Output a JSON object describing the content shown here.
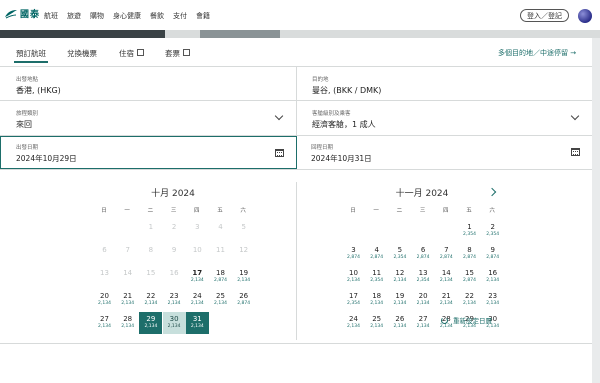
{
  "header": {
    "logo_text": "國泰",
    "nav": [
      "航班",
      "旅遊",
      "購物",
      "身心健康",
      "餐飲",
      "支付",
      "會籍"
    ],
    "login_label": "登入／登記"
  },
  "tabs": [
    {
      "label": "預訂航班"
    },
    {
      "label": "兌換機票"
    },
    {
      "label": "住宿"
    },
    {
      "label": "套票"
    }
  ],
  "multi_city_link": "多個目的地／中途停留 →",
  "form": {
    "origin_label": "出發地點",
    "origin_value": "香港, (HKG)",
    "destination_label": "目的地",
    "destination_value": "曼谷, (BKK / DMK)",
    "trip_type_label": "旅程類別",
    "trip_type_value": "來回",
    "cabin_label": "客艙級別及乘客",
    "cabin_value": "經濟客艙，1 成人",
    "depart_label": "出發日期",
    "depart_value": "2024年10月29日",
    "return_label": "回程日期",
    "return_value": "2024年10月31日"
  },
  "calendar": {
    "weekdays": [
      "日",
      "一",
      "二",
      "三",
      "四",
      "五",
      "六"
    ],
    "months": [
      {
        "title": "十月 2024",
        "first_weekday": 2,
        "days": 31,
        "disabled_before": 17,
        "prices": {
          "17": "2,134",
          "18": "2,874",
          "19": "2,134",
          "20": "2,134",
          "21": "2,134",
          "22": "2,134",
          "23": "2,134",
          "24": "2,134",
          "25": "2,134",
          "26": "2,874",
          "27": "2,134",
          "28": "2,134",
          "29": "2,134",
          "30": "2,134",
          "31": "2,134"
        },
        "bold_day": 17,
        "selected": [
          29,
          31
        ],
        "range": [
          30
        ]
      },
      {
        "title": "十一月 2024",
        "first_weekday": 5,
        "days": 30,
        "disabled_before": 1,
        "prices": {
          "1": "2,354",
          "2": "2,354",
          "3": "2,874",
          "4": "2,874",
          "5": "2,354",
          "6": "2,874",
          "7": "2,874",
          "8": "2,874",
          "9": "2,874",
          "10": "2,134",
          "11": "2,354",
          "12": "2,134",
          "13": "2,354",
          "14": "2,134",
          "15": "2,874",
          "16": "2,134",
          "17": "2,354",
          "18": "2,134",
          "19": "2,134",
          "20": "2,134",
          "21": "2,134",
          "22": "2,134",
          "23": "2,134",
          "24": "2,134",
          "25": "2,134",
          "26": "2,134",
          "27": "2,134",
          "28": "2,134",
          "29": "2,134",
          "30": "2,134"
        },
        "bold_day": null,
        "selected": [],
        "range": []
      }
    ]
  },
  "reset_label": "重新設定日曆",
  "colors": {
    "accent": "#1d6e6a",
    "range": "#c7dfdc"
  }
}
